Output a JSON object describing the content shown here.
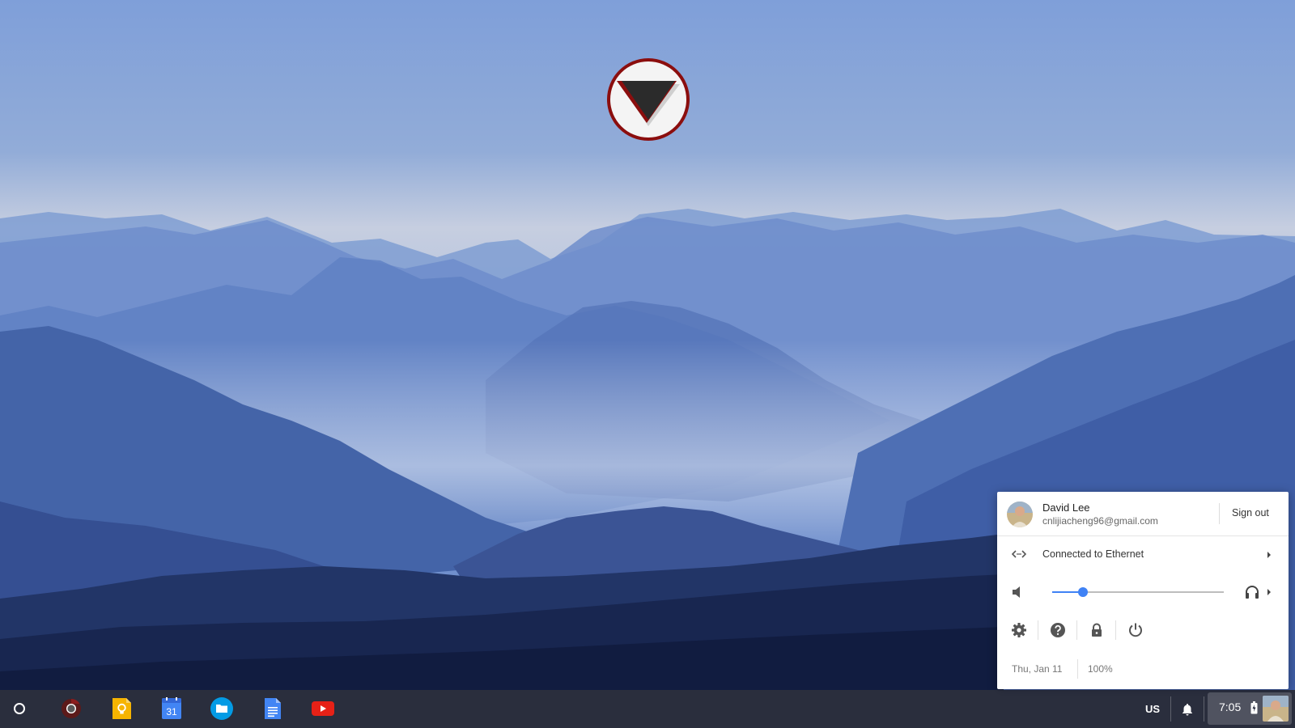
{
  "colors": {
    "sky_top": "#7f9fd8",
    "mountain_dark": "#14204a",
    "shelf": "#181c2c",
    "accent": "#3f82f5",
    "logo_ring": "#8b0e0e"
  },
  "shelf": {
    "launcher_icon": "circle-launcher-icon",
    "apps": [
      {
        "name": "Chrome",
        "icon": "chrome-icon"
      },
      {
        "name": "Keep",
        "icon": "keep-icon"
      },
      {
        "name": "Calendar",
        "icon": "calendar-icon",
        "text": "31"
      },
      {
        "name": "Files",
        "icon": "files-icon"
      },
      {
        "name": "Docs",
        "icon": "docs-icon"
      },
      {
        "name": "YouTube",
        "icon": "youtube-icon"
      }
    ],
    "ime": "US",
    "clock": "7:05"
  },
  "tray_bubble": {
    "user": {
      "name": "David Lee",
      "email": "cnlijiacheng96@gmail.com",
      "sign_out": "Sign out"
    },
    "network": {
      "label": "Connected to Ethernet"
    },
    "volume": {
      "level": 0.18
    },
    "buttons": [
      "settings-icon",
      "help-icon",
      "lock-icon",
      "power-icon"
    ],
    "date": "Thu, Jan 11",
    "battery": "100%"
  }
}
